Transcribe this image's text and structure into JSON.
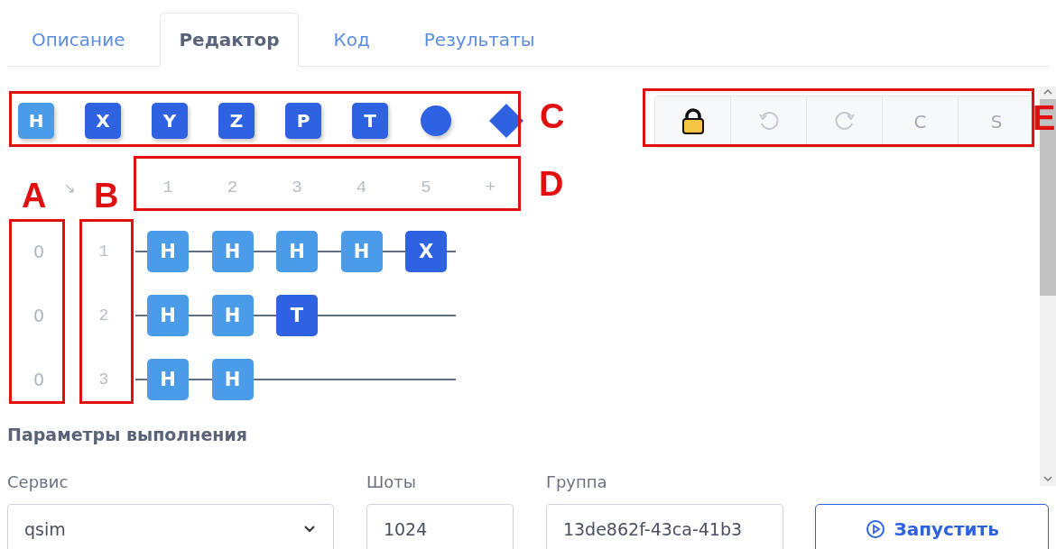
{
  "tabs": [
    {
      "label": "Описание",
      "selected": false
    },
    {
      "label": "Редактор",
      "selected": true
    },
    {
      "label": "Код",
      "selected": false
    },
    {
      "label": "Результаты",
      "selected": false
    }
  ],
  "palette": [
    {
      "kind": "gate",
      "label": "H",
      "color": "#4a9be8"
    },
    {
      "kind": "gate",
      "label": "X",
      "color": "#2f62e0"
    },
    {
      "kind": "gate",
      "label": "Y",
      "color": "#2f62e0"
    },
    {
      "kind": "gate",
      "label": "Z",
      "color": "#2f62e0"
    },
    {
      "kind": "gate",
      "label": "P",
      "color": "#2f62e0"
    },
    {
      "kind": "gate",
      "label": "T",
      "color": "#2f62e0"
    },
    {
      "kind": "circle",
      "color": "#2f62e0"
    },
    {
      "kind": "diamond",
      "color": "#2f62e0"
    }
  ],
  "toolbar": [
    {
      "kind": "lock",
      "disabled": false
    },
    {
      "kind": "undo",
      "disabled": true
    },
    {
      "kind": "redo",
      "disabled": true
    },
    {
      "kind": "text",
      "label": "C",
      "disabled": true
    },
    {
      "kind": "text",
      "label": "S",
      "disabled": true
    }
  ],
  "column_header": {
    "arrow": "↘",
    "columns": [
      "1",
      "2",
      "3",
      "4",
      "5",
      "+"
    ]
  },
  "qubits": [
    {
      "init": "0",
      "index": "1",
      "gates": [
        {
          "label": "H",
          "color": "#4a9be8"
        },
        {
          "label": "H",
          "color": "#4a9be8"
        },
        {
          "label": "H",
          "color": "#4a9be8"
        },
        {
          "label": "H",
          "color": "#4a9be8"
        },
        {
          "label": "X",
          "color": "#2f62e0"
        }
      ]
    },
    {
      "init": "0",
      "index": "2",
      "gates": [
        {
          "label": "H",
          "color": "#4a9be8"
        },
        {
          "label": "H",
          "color": "#4a9be8"
        },
        {
          "label": "T",
          "color": "#2f62e0"
        }
      ]
    },
    {
      "init": "0",
      "index": "3",
      "gates": [
        {
          "label": "H",
          "color": "#4a9be8"
        },
        {
          "label": "H",
          "color": "#4a9be8"
        }
      ]
    }
  ],
  "run_parameters": {
    "heading": "Параметры выполнения",
    "service": {
      "label": "Сервис",
      "value": "qsim"
    },
    "shots": {
      "label": "Шоты",
      "value": "1024"
    },
    "group": {
      "label": "Группа",
      "value": "13de862f-43ca-41b3"
    },
    "run_button": "Запустить"
  },
  "annotations": [
    {
      "label": "A"
    },
    {
      "label": "B"
    },
    {
      "label": "C"
    },
    {
      "label": "D"
    },
    {
      "label": "E"
    }
  ]
}
